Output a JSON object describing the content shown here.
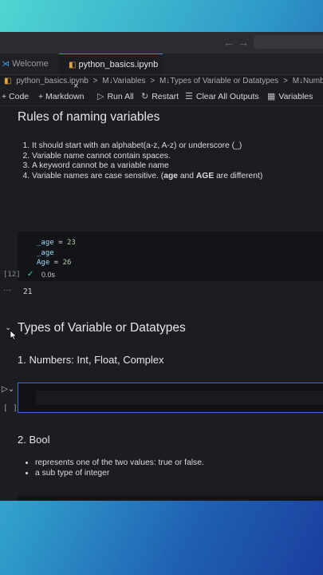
{
  "tabs": [
    {
      "label": "Welcome",
      "icon": "vscode-icon"
    },
    {
      "label": "python_basics.ipynb",
      "icon": "notebook-icon",
      "close": "×"
    }
  ],
  "nav": {
    "back": "←",
    "forward": "→"
  },
  "breadcrumb": {
    "file": "python_basics.ipynb",
    "sep": ">",
    "items": [
      "M↓Variables",
      "M↓Types of Variable or Datatypes",
      "M↓Numbers: Int, F"
    ]
  },
  "toolbar": {
    "code": "+ Code",
    "markdown": "+ Markdown",
    "run_all": "Run All",
    "restart": "Restart",
    "clear": "Clear All Outputs",
    "variables": "Variables"
  },
  "cells": {
    "rules_heading": "Rules of naming variables",
    "rules": [
      "It should start with an alphabet(a-z, A-z) or underscore (_)",
      "Variable name cannot contain spaces.",
      "A keyword cannot be a variable name"
    ],
    "rule4_pre": "Variable names are case sensitive. (",
    "rule4_b1": "age",
    "rule4_mid": " and ",
    "rule4_b2": "AGE",
    "rule4_post": " are different)",
    "code_line1_var": "_age",
    "code_line1_op": " = ",
    "code_line1_num": "23",
    "code_line2": "_age",
    "code_line3_var": "Age",
    "code_line3_op": " = ",
    "code_line3_num": "26",
    "exec_count": "[12]",
    "check": "✓",
    "time": "0.0s",
    "output_dots": "···",
    "output": "21",
    "types_heading": "Types of Variable or Datatypes",
    "numbers_heading": "1. Numbers: Int, Float, Complex",
    "empty_exec": "[ ]",
    "bool_heading": "2. Bool",
    "bool_items": [
      "represents one of the two values: true or false.",
      "a sub type of integer"
    ],
    "empty_exec2": "[ ]"
  }
}
